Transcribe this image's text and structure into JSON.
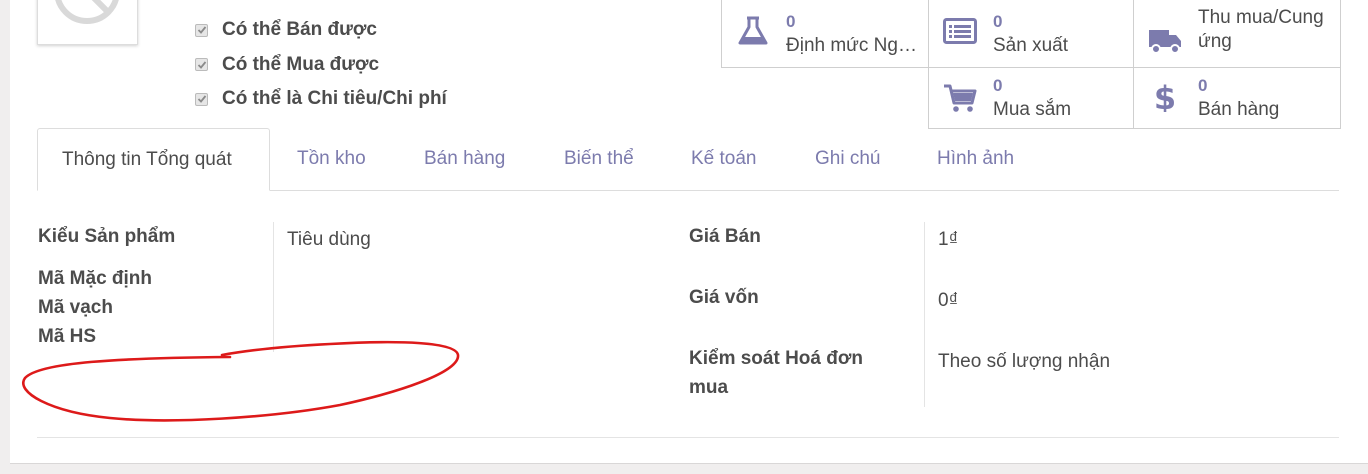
{
  "checkboxes": [
    {
      "label": "Có thể Bán được",
      "checked": true
    },
    {
      "label": "Có thể Mua được",
      "checked": true
    },
    {
      "label": "Có thể là Chi tiêu/Chi phí",
      "checked": true
    }
  ],
  "smart_buttons": {
    "bom": {
      "count": "0",
      "label": "Định mức Ng…",
      "icon": "flask-icon"
    },
    "manufacturing": {
      "count": "0",
      "label": "Sản xuất",
      "icon": "list-icon"
    },
    "procurement": {
      "label_line1": "Thu mua/Cung",
      "label_line2": "ứng",
      "icon": "truck-icon"
    },
    "purchases": {
      "count": "0",
      "label": "Mua sắm",
      "icon": "cart-icon"
    },
    "sales": {
      "count": "0",
      "label": "Bán hàng",
      "icon": "dollar-icon"
    }
  },
  "tabs": [
    {
      "label": "Thông tin Tổng quát",
      "active": true
    },
    {
      "label": "Tồn kho"
    },
    {
      "label": "Bán hàng"
    },
    {
      "label": "Biến thể"
    },
    {
      "label": "Kế toán"
    },
    {
      "label": "Ghi chú"
    },
    {
      "label": "Hình ảnh"
    }
  ],
  "general": {
    "product_type_label": "Kiểu Sản phẩm",
    "product_type_value": "Tiêu dùng",
    "default_code_label": "Mã Mặc định",
    "barcode_label": "Mã vạch",
    "hs_code_label": "Mã HS",
    "sale_price_label": "Giá Bán",
    "sale_price_value": "1₫",
    "cost_label": "Giá vốn",
    "cost_value": "0₫",
    "bill_control_label_line1": "Kiểm soát Hoá đơn",
    "bill_control_label_line2": "mua",
    "bill_control_value": "Theo số lượng nhận"
  },
  "colors": {
    "accent": "#7c7bad",
    "text": "#4c4c4c",
    "annotation": "#dd1a1a"
  }
}
